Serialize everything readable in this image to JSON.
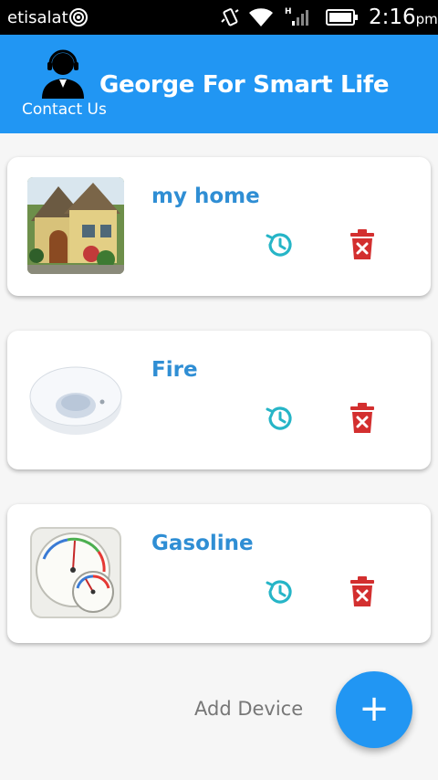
{
  "status_bar": {
    "carrier": "etisalat",
    "time": "2:16",
    "ampm": "pm",
    "icons": [
      "hotspot-icon",
      "vibrate-icon",
      "wifi-icon",
      "signal-icon",
      "battery-icon"
    ]
  },
  "header": {
    "title": "George For Smart Life",
    "contact_label": "Contact Us",
    "background_color": "#2196f3",
    "avatar_icon": "support-agent-icon"
  },
  "devices": [
    {
      "name": "my home",
      "image": "house-image"
    },
    {
      "name": "Fire",
      "image": "motion-sensor-image"
    },
    {
      "name": "Gasoline",
      "image": "hygrometer-image"
    }
  ],
  "actions": {
    "history_icon": "history-icon",
    "delete_icon": "delete-icon",
    "history_color": "#26b5c7",
    "delete_color": "#d32f2f"
  },
  "add_device": {
    "label": "Add Device",
    "fab_symbol": "+"
  }
}
